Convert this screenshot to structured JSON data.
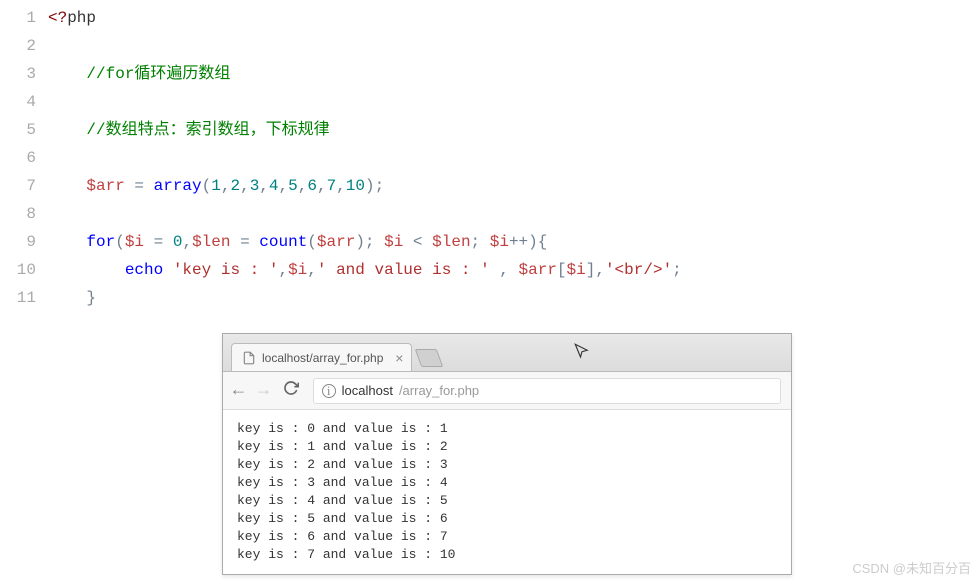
{
  "code": {
    "line_numbers": [
      "1",
      "2",
      "3",
      "4",
      "5",
      "6",
      "7",
      "8",
      "9",
      "10",
      "11"
    ],
    "l1": {
      "a": "<?",
      "b": "php"
    },
    "l3": {
      "comment": "//for循环遍历数组"
    },
    "l5": {
      "comment": "//数组特点：索引数组，下标规律"
    },
    "l7": {
      "var": "$arr",
      "eq": " = ",
      "func": "array",
      "open": "(",
      "v1": "1",
      "c": ",",
      "v2": "2",
      "v3": "3",
      "v4": "4",
      "v5": "5",
      "v6": "6",
      "v7": "7",
      "v8": "10",
      "close": ");"
    },
    "l9": {
      "for": "for",
      "open": "(",
      "v_i": "$i",
      "eq": " = ",
      "zero": "0",
      "c": ",",
      "v_len": "$len",
      "func": "count",
      "open2": "(",
      "v_arr": "$arr",
      "close2": ")",
      "sc": "; ",
      "lt": " < ",
      "inc": "++",
      "closep": ")",
      "brace": "{"
    },
    "l10": {
      "echo": "echo",
      "sp": " ",
      "s1": "'key is : '",
      "c": ",",
      "v_i": "$i",
      "s2": "' and value is : '",
      "sp2": " , ",
      "v_arr": "$arr",
      "ob": "[",
      "cb": "]",
      "s3": "'<br/>'",
      "end": ";"
    },
    "l11": {
      "brace": "}"
    }
  },
  "browser": {
    "tab_title": "localhost/array_for.php",
    "url_host": "localhost",
    "url_path": "/array_for.php",
    "output": [
      "key is : 0 and value is : 1",
      "key is : 1 and value is : 2",
      "key is : 2 and value is : 3",
      "key is : 3 and value is : 4",
      "key is : 4 and value is : 5",
      "key is : 5 and value is : 6",
      "key is : 6 and value is : 7",
      "key is : 7 and value is : 10"
    ]
  },
  "watermark": "CSDN @未知百分百"
}
